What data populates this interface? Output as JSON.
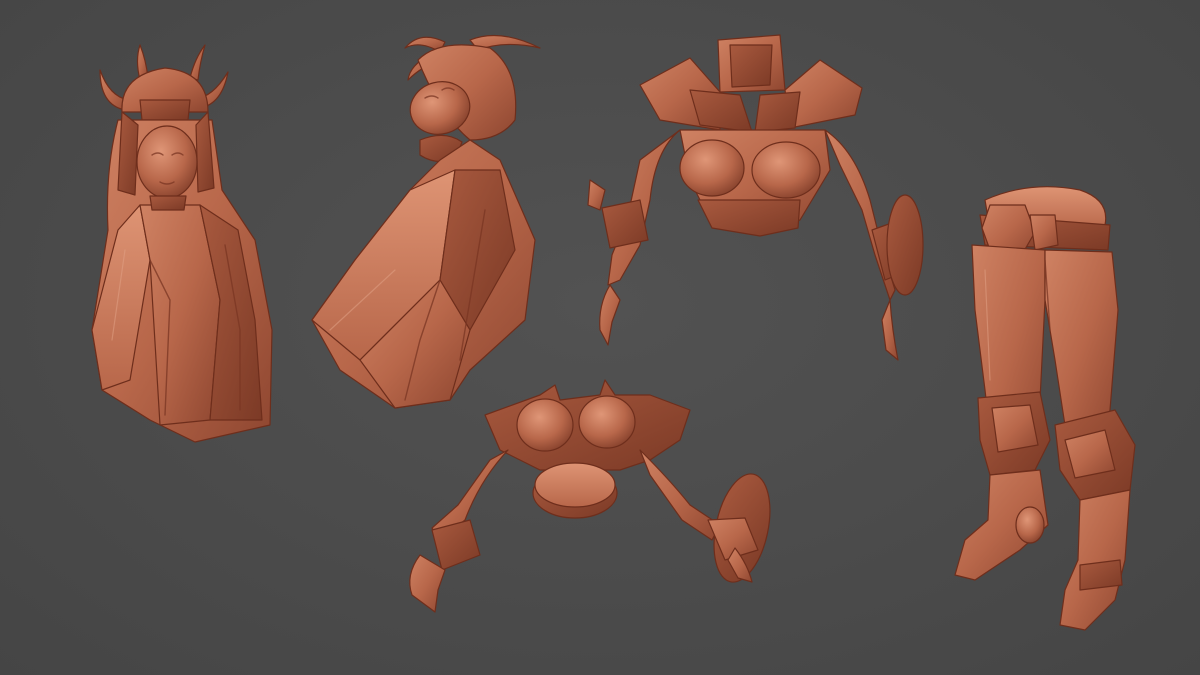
{
  "scene": {
    "background_color": "#4a4a4a",
    "material_color": "#b8674a",
    "pieces": [
      {
        "name": "head-front"
      },
      {
        "name": "head-tilted"
      },
      {
        "name": "torso-front"
      },
      {
        "name": "torso-top"
      },
      {
        "name": "legs"
      }
    ]
  }
}
